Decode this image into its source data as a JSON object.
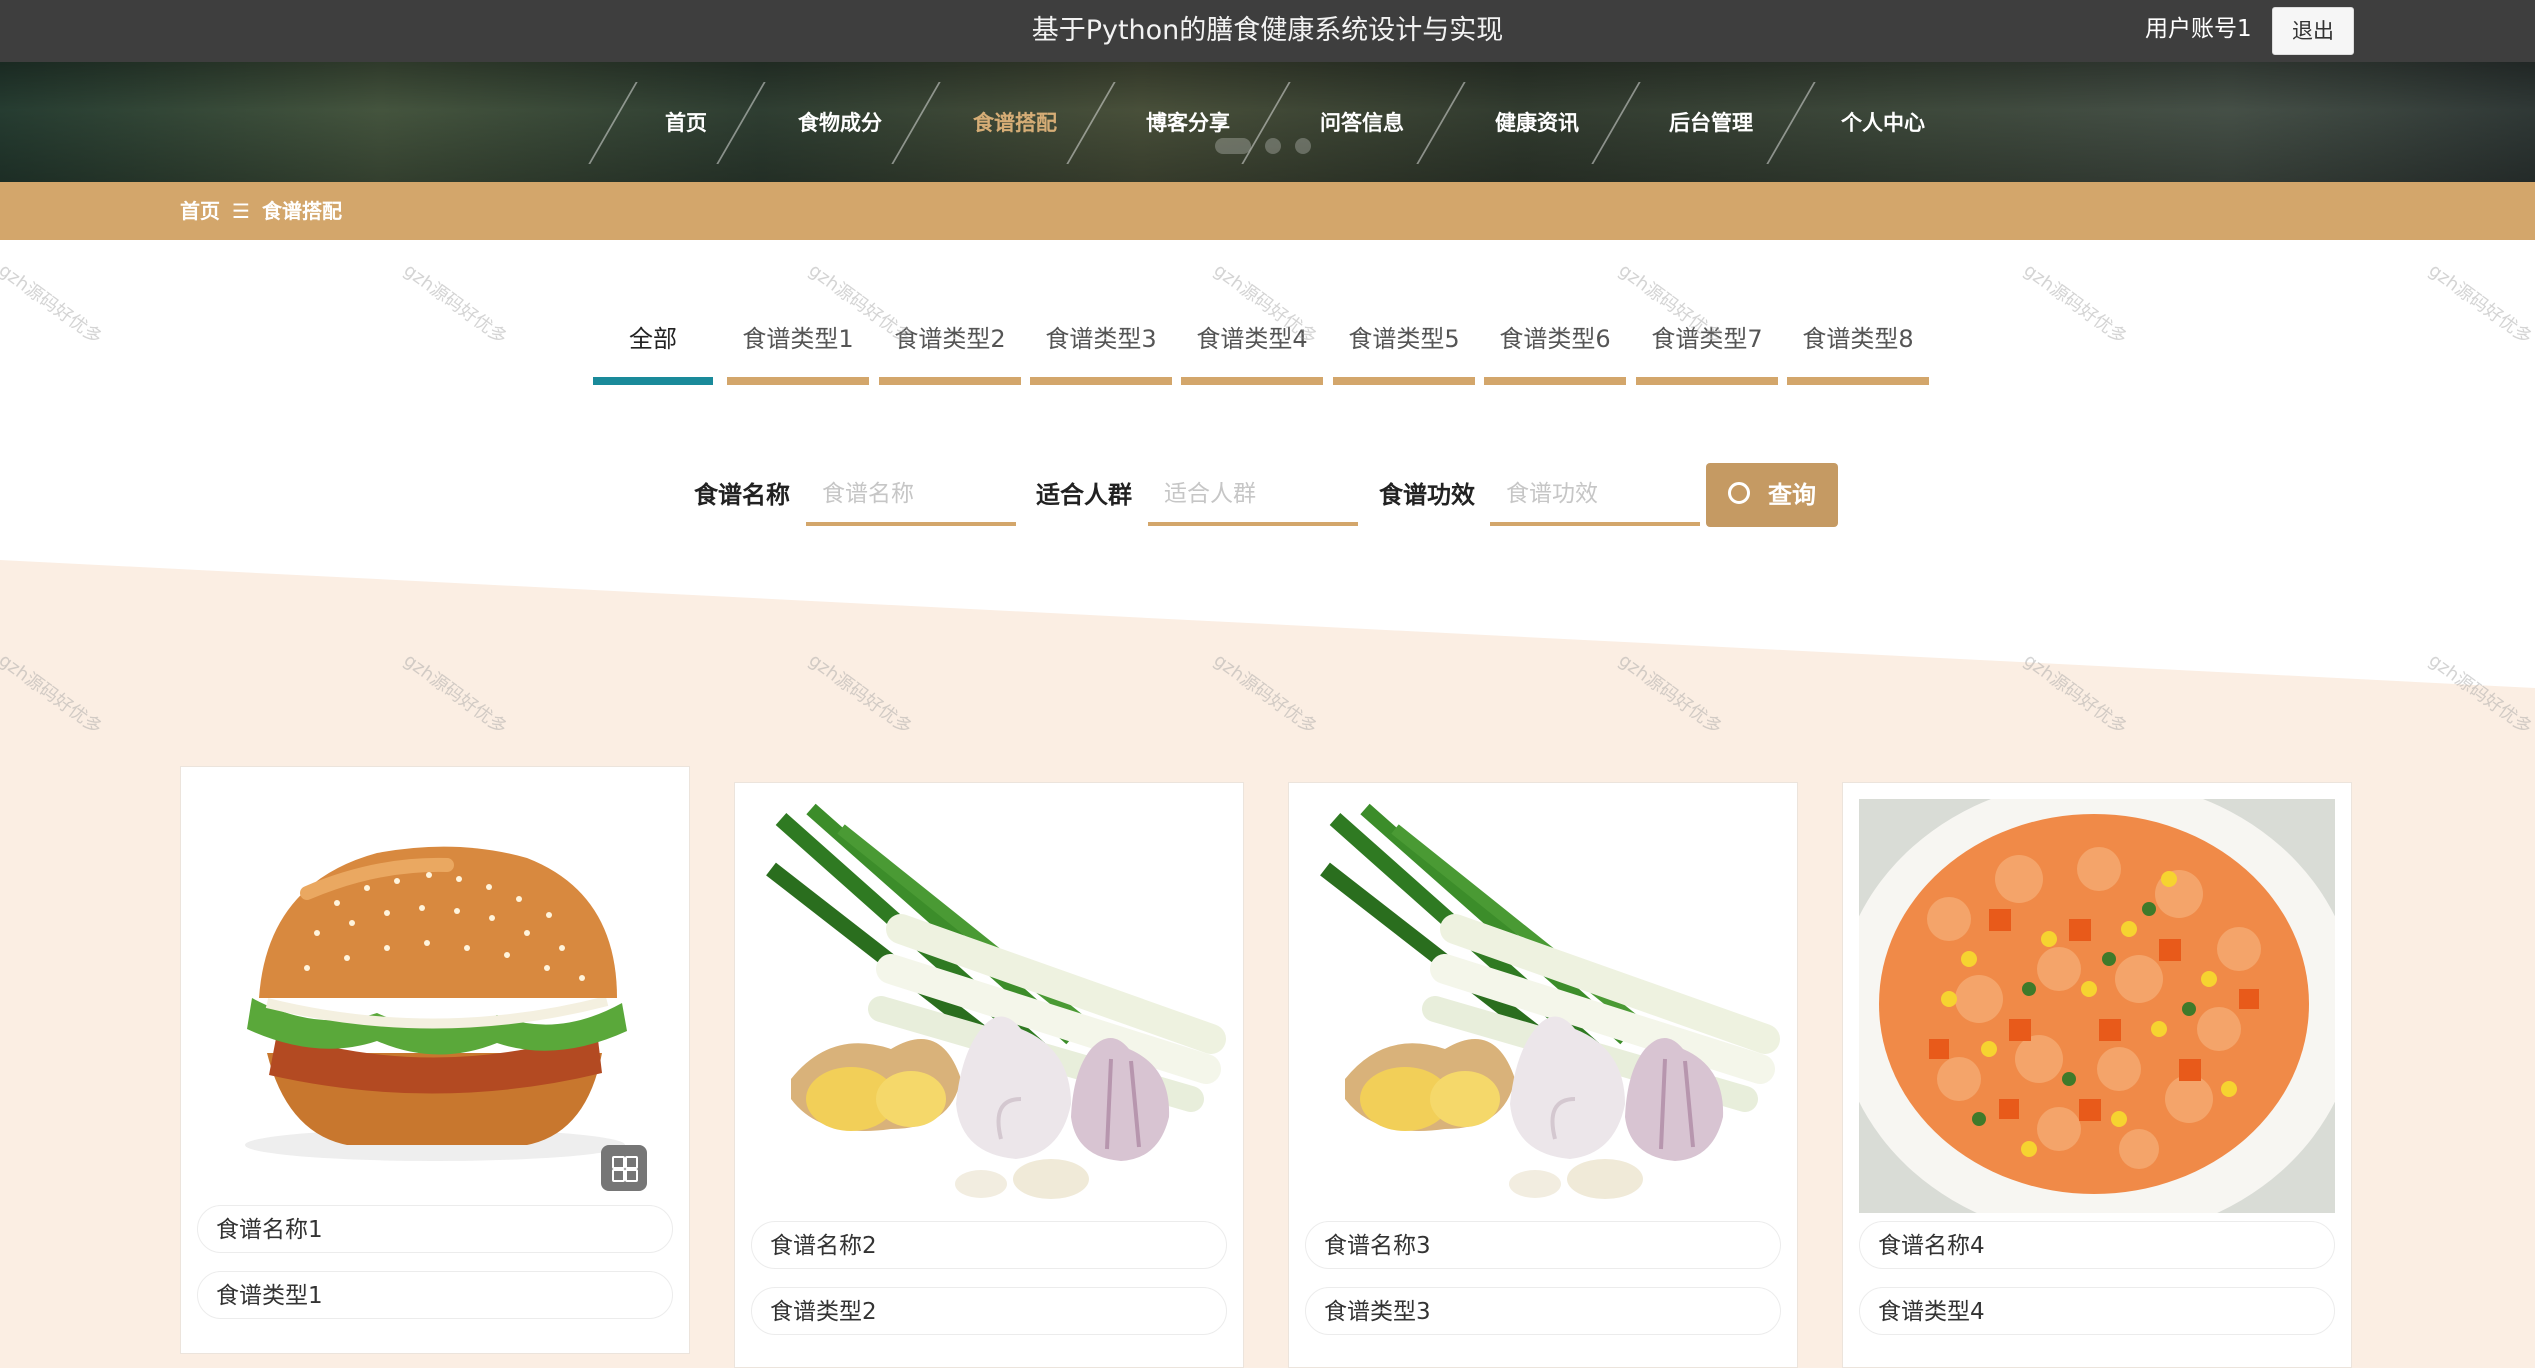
{
  "header": {
    "site_title": "基于Python的膳食健康系统设计与实现",
    "account": "用户账号1",
    "logout": "退出"
  },
  "nav": {
    "items": [
      "首页",
      "食物成分",
      "食谱搭配",
      "博客分享",
      "问答信息",
      "健康资讯",
      "后台管理",
      "个人中心"
    ],
    "active_index": 2
  },
  "breadcrumb": {
    "home": "首页",
    "separator": "☰",
    "current": "食谱搭配"
  },
  "tabs": {
    "items": [
      "全部",
      "食谱类型1",
      "食谱类型2",
      "食谱类型3",
      "食谱类型4",
      "食谱类型5",
      "食谱类型6",
      "食谱类型7",
      "食谱类型8"
    ],
    "active_index": 0
  },
  "search": {
    "name_label": "食谱名称",
    "name_placeholder": "食谱名称",
    "crowd_label": "适合人群",
    "crowd_placeholder": "适合人群",
    "effect_label": "食谱功效",
    "effect_placeholder": "食谱功效",
    "button_label": "查询",
    "button_icon": "search-icon"
  },
  "watermark": "gzh源码好优多",
  "cards": [
    {
      "name": "食谱名称1",
      "type": "食谱类型1",
      "image": "burger"
    },
    {
      "name": "食谱名称2",
      "type": "食谱类型2",
      "image": "scallion-ginger-garlic"
    },
    {
      "name": "食谱名称3",
      "type": "食谱类型3",
      "image": "scallion-ginger-garlic"
    },
    {
      "name": "食谱名称4",
      "type": "食谱类型4",
      "image": "shrimp-vegetables"
    }
  ],
  "colors": {
    "accent": "#d3a66b",
    "active_tab": "#1a8a9a",
    "topbar": "#3e3e3e",
    "band": "#fbeee3"
  }
}
